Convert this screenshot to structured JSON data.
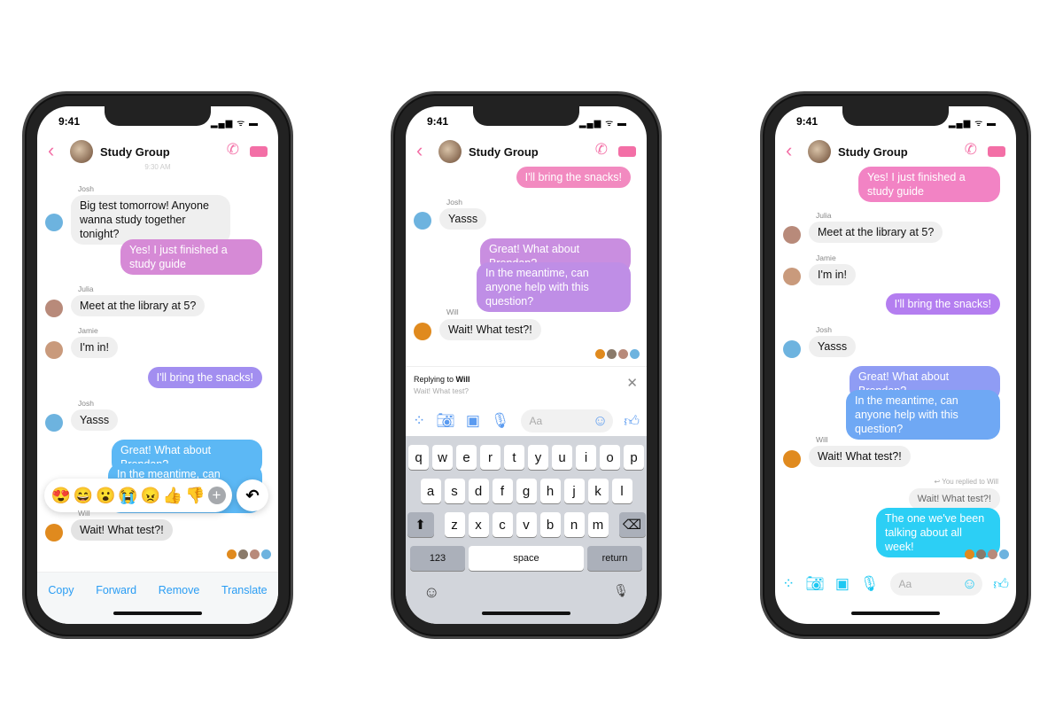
{
  "status": {
    "time": "9:41",
    "signal": "▂▄▆ ᯤ ▬"
  },
  "header": {
    "title": "Study Group",
    "back": "‹",
    "call": "✆"
  },
  "colors": {
    "pink": "#f36fa6",
    "gray_bubble": "#efefef",
    "blue_icons": "#5b9bf0",
    "cyan_icons": "#1cc8f2"
  },
  "phone1": {
    "timestamp": "9:30 AM",
    "messages": [
      {
        "sender": "Josh",
        "text": "Big test tomorrow! Anyone wanna study together tonight?"
      },
      {
        "text": "Yes! I just finished a study guide"
      },
      {
        "sender": "Julia",
        "text": "Meet at the library at 5?"
      },
      {
        "sender": "Jamie",
        "text": "I'm in!"
      },
      {
        "text": "I'll bring the snacks!"
      },
      {
        "sender": "Josh",
        "text": "Yasss"
      },
      {
        "text": "Great! What about Brendan?"
      },
      {
        "text": "In the meantime, can anyone help with this question?"
      },
      {
        "sender": "Will",
        "text": "Wait! What test?!"
      }
    ],
    "reactions": [
      "😍",
      "😄",
      "😮",
      "😭",
      "😠",
      "👍",
      "👎"
    ],
    "more_reactions": "+",
    "reply_icon": "reply-arrow",
    "actions": [
      "Copy",
      "Forward",
      "Remove",
      "Translate"
    ]
  },
  "phone2": {
    "messages": [
      {
        "text": "I'll bring the snacks!"
      },
      {
        "sender": "Josh",
        "text": "Yasss"
      },
      {
        "text": "Great! What about Brendan?"
      },
      {
        "text": "In the meantime, can anyone help with this question?"
      },
      {
        "sender": "Will",
        "text": "Wait! What test?!"
      }
    ],
    "reply": {
      "prefix": "Replying to ",
      "name": "Will",
      "quote": "Wait! What test?",
      "close": "✕"
    },
    "composer": {
      "placeholder": "Aa"
    },
    "keyboard": {
      "row1": [
        "q",
        "w",
        "e",
        "r",
        "t",
        "y",
        "u",
        "i",
        "o",
        "p"
      ],
      "row2": [
        "a",
        "s",
        "d",
        "f",
        "g",
        "h",
        "j",
        "k",
        "l"
      ],
      "row3": [
        "z",
        "x",
        "c",
        "v",
        "b",
        "n",
        "m"
      ],
      "shift": "⬆",
      "delete": "⌫",
      "numbers": "123",
      "space": "space",
      "return": "return",
      "emoji": "☺",
      "mic": "🎙"
    }
  },
  "phone3": {
    "messages": [
      {
        "text": "Yes! I just finished a study guide"
      },
      {
        "sender": "Julia",
        "text": "Meet at the library at 5?"
      },
      {
        "sender": "Jamie",
        "text": "I'm in!"
      },
      {
        "text": "I'll bring the snacks!"
      },
      {
        "sender": "Josh",
        "text": "Yasss"
      },
      {
        "text": "Great! What about Brendan?"
      },
      {
        "text": "In the meantime, can anyone help with this question?"
      },
      {
        "sender": "Will",
        "text": "Wait! What test?!"
      },
      {
        "text": "The one we've been talking about all week!"
      }
    ],
    "replied_label": "↩ You replied to Will",
    "quoted": "Wait! What test?!",
    "composer": {
      "placeholder": "Aa"
    }
  }
}
